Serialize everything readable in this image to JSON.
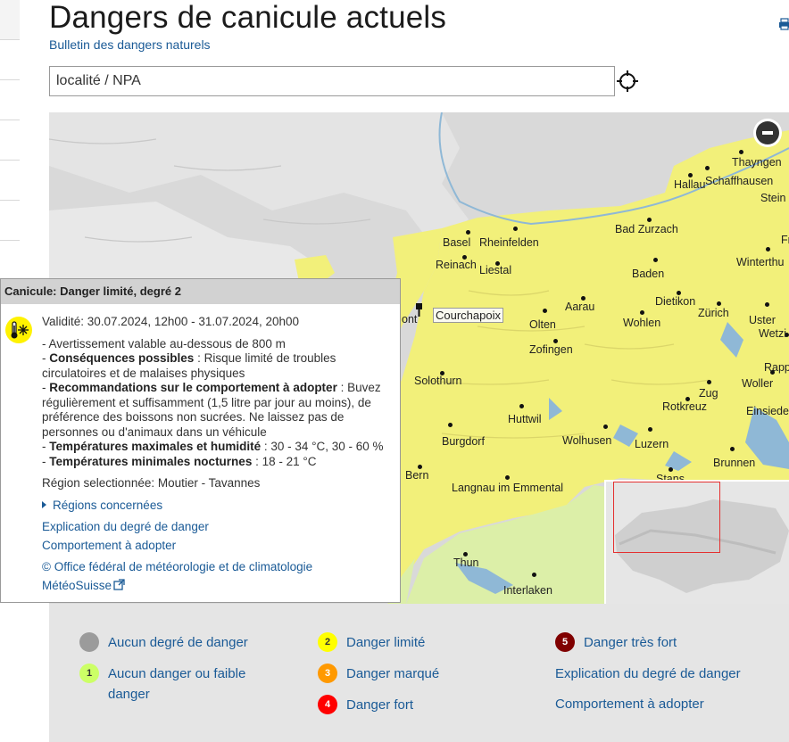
{
  "header": {
    "title": "Dangers de canicule actuels",
    "subtitle": "Bulletin des dangers naturels"
  },
  "search": {
    "placeholder": "localité / NPA"
  },
  "map": {
    "marker_label": "Courchapoix",
    "cities": [
      {
        "name": "Thayngen"
      },
      {
        "name": "Hallau"
      },
      {
        "name": "Schaffhausen"
      },
      {
        "name": "Stein"
      },
      {
        "name": "Bad Zurzach"
      },
      {
        "name": "Basel"
      },
      {
        "name": "Rheinfelden"
      },
      {
        "name": "Fr"
      },
      {
        "name": "Reinach"
      },
      {
        "name": "Liestal"
      },
      {
        "name": "Winterthu"
      },
      {
        "name": "Baden"
      },
      {
        "name": "Dietikon"
      },
      {
        "name": "Aarau"
      },
      {
        "name": "Zürich"
      },
      {
        "name": "Uster"
      },
      {
        "name": "Olten"
      },
      {
        "name": "Wohlen"
      },
      {
        "name": "Wetzi"
      },
      {
        "name": "Zofingen"
      },
      {
        "name": "Rapp"
      },
      {
        "name": "Solothurn"
      },
      {
        "name": "Woller"
      },
      {
        "name": "Zug"
      },
      {
        "name": "Rotkreuz"
      },
      {
        "name": "Einsiede"
      },
      {
        "name": "Huttwil"
      },
      {
        "name": "Burgdorf"
      },
      {
        "name": "Wolhusen"
      },
      {
        "name": "Luzern"
      },
      {
        "name": "Brunnen"
      },
      {
        "name": "Bern"
      },
      {
        "name": "Stans"
      },
      {
        "name": "Langnau im Emmental"
      },
      {
        "name": "Thun"
      },
      {
        "name": "Interlaken"
      },
      {
        "name": "ont"
      }
    ]
  },
  "popup": {
    "title": "Canicule: Danger limité, degré 2",
    "validity": "Validité: 30.07.2024, 12h00 - 31.07.2024, 20h00",
    "warning": "- Avertissement valable au-dessous de 800 m",
    "consequences_label": "Conséquences possibles",
    "consequences_text": " : Risque limité de troubles circulatoires et de malaises physiques",
    "recommendations_label": "Recommandations sur le comportement à adopter",
    "recommendations_text": " : Buvez régulièrement et suffisamment (1,5 litre par jour au moins), de préférence des boissons non sucrées. Ne laissez pas de personnes ou d'animaux dans un véhicule",
    "tmax_label": "Températures maximales et humidité",
    "tmax_text": " : 30 - 34 °C, 30 - 60 %",
    "tmin_label": "Températures minimales nocturnes",
    "tmin_text": " : 18 - 21 °C",
    "region": "Région selectionnée: Moutier - Tavannes",
    "regions_link": "Régions concernées",
    "explanation_link": "Explication du degré de danger",
    "behaviour_link": "Comportement à adopter",
    "copyright": "© Office fédéral de météorologie et de climatologie",
    "meteoswiss_link": "MétéoSuisse"
  },
  "legend": {
    "items": [
      {
        "num": "",
        "label": "Aucun degré de danger",
        "color": "#9b9b9b"
      },
      {
        "num": "1",
        "label": "Aucun danger ou faible danger",
        "color": "#ccff66"
      },
      {
        "num": "2",
        "label": "Danger limité",
        "color": "#ffff00"
      },
      {
        "num": "3",
        "label": "Danger marqué",
        "color": "#ff9900"
      },
      {
        "num": "4",
        "label": "Danger fort",
        "color": "#ff0000"
      },
      {
        "num": "5",
        "label": "Danger très fort",
        "color": "#800000"
      }
    ],
    "explanation_link": "Explication du degré de danger",
    "behaviour_link": "Comportement à adopter"
  },
  "colors": {
    "danger_2": "#f2f07a",
    "danger_1": "#dcefa8",
    "link": "#1a5a96"
  }
}
